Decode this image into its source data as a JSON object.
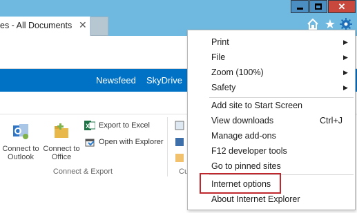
{
  "window": {
    "tab_title": "es - All Documents",
    "tab_close": "✕",
    "controls": {
      "minimize": "minimize",
      "maximize": "maximize",
      "close": "✕"
    },
    "toolbar_icons": [
      "home-icon",
      "favorites-star-icon",
      "tools-gear-icon"
    ]
  },
  "sharepoint_nav": {
    "links": [
      "Newsfeed",
      "SkyDrive"
    ]
  },
  "ribbon": {
    "connect_to_outlook": "Connect to Outlook",
    "connect_to_office": "Connect to Office",
    "export_to_excel": "Export to Excel",
    "open_with_explorer": "Open with Explorer",
    "group_label": "Connect & Export",
    "cut_group_label": "Cu"
  },
  "tools_menu": {
    "items": [
      {
        "label": "Print",
        "submenu": true
      },
      {
        "label": "File",
        "submenu": true
      },
      {
        "label": "Zoom (100%)",
        "submenu": true
      },
      {
        "label": "Safety",
        "submenu": true
      },
      {
        "label": "Add site to Start Screen"
      },
      {
        "label": "View downloads",
        "shortcut": "Ctrl+J"
      },
      {
        "label": "Manage add-ons"
      },
      {
        "label": "F12 developer tools"
      },
      {
        "label": "Go to pinned sites"
      },
      {
        "label": "Internet options",
        "highlighted": true
      },
      {
        "label": "About Internet Explorer"
      }
    ],
    "arrow_glyph": "▶"
  },
  "colors": {
    "titlebar": "#6fb9e0",
    "sharepoint_blue": "#0072c6",
    "highlight_border": "#c0272d"
  }
}
